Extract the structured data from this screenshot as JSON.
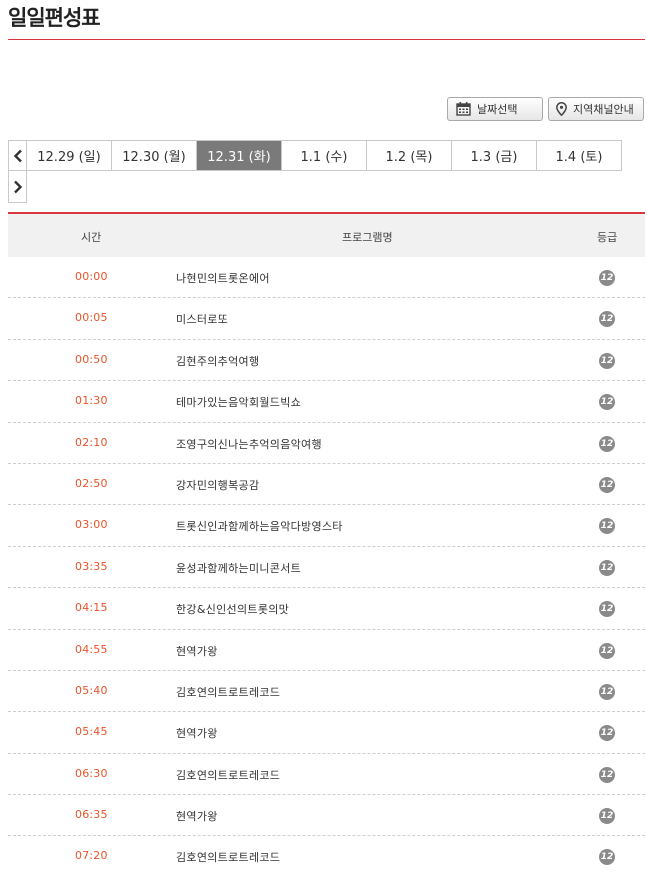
{
  "page_title": "일일편성표",
  "toolbar": {
    "date_select_label": "날짜선택",
    "region_channel_label": "지역채널안내"
  },
  "date_tabs": [
    {
      "label": "12.29 (일)",
      "active": false
    },
    {
      "label": "12.30 (월)",
      "active": false
    },
    {
      "label": "12.31 (화)",
      "active": true
    },
    {
      "label": "1.1 (수)",
      "active": false
    },
    {
      "label": "1.2 (목)",
      "active": false
    },
    {
      "label": "1.3 (금)",
      "active": false
    },
    {
      "label": "1.4 (토)",
      "active": false
    }
  ],
  "table": {
    "headers": {
      "time": "시간",
      "program": "프로그램명",
      "grade": "등급"
    },
    "rows": [
      {
        "time": "00:00",
        "program": "나현민의트롯온에어",
        "grade": "12"
      },
      {
        "time": "00:05",
        "program": "미스터로또",
        "grade": "12"
      },
      {
        "time": "00:50",
        "program": "김현주의추억여행",
        "grade": "12"
      },
      {
        "time": "01:30",
        "program": "테마가있는음악회월드빅쇼",
        "grade": "12"
      },
      {
        "time": "02:10",
        "program": "조영구의신나는추억의음악여행",
        "grade": "12"
      },
      {
        "time": "02:50",
        "program": "강자민의행복공감",
        "grade": "12"
      },
      {
        "time": "03:00",
        "program": "트롯신인과함께하는음악다방영스타",
        "grade": "12"
      },
      {
        "time": "03:35",
        "program": "윤성과함께하는미니콘서트",
        "grade": "12"
      },
      {
        "time": "04:15",
        "program": "한강&신인선의트롯의맛",
        "grade": "12"
      },
      {
        "time": "04:55",
        "program": "현역가왕",
        "grade": "12"
      },
      {
        "time": "05:40",
        "program": "김호연의트로트레코드",
        "grade": "12"
      },
      {
        "time": "05:45",
        "program": "현역가왕",
        "grade": "12"
      },
      {
        "time": "06:30",
        "program": "김호연의트로트레코드",
        "grade": "12"
      },
      {
        "time": "06:35",
        "program": "현역가왕",
        "grade": "12"
      },
      {
        "time": "07:20",
        "program": "김호연의트로트레코드",
        "grade": "12"
      }
    ]
  },
  "colors": {
    "accent": "#d9363e",
    "time_text": "#e8542a",
    "active_tab": "#7a7a7a"
  }
}
